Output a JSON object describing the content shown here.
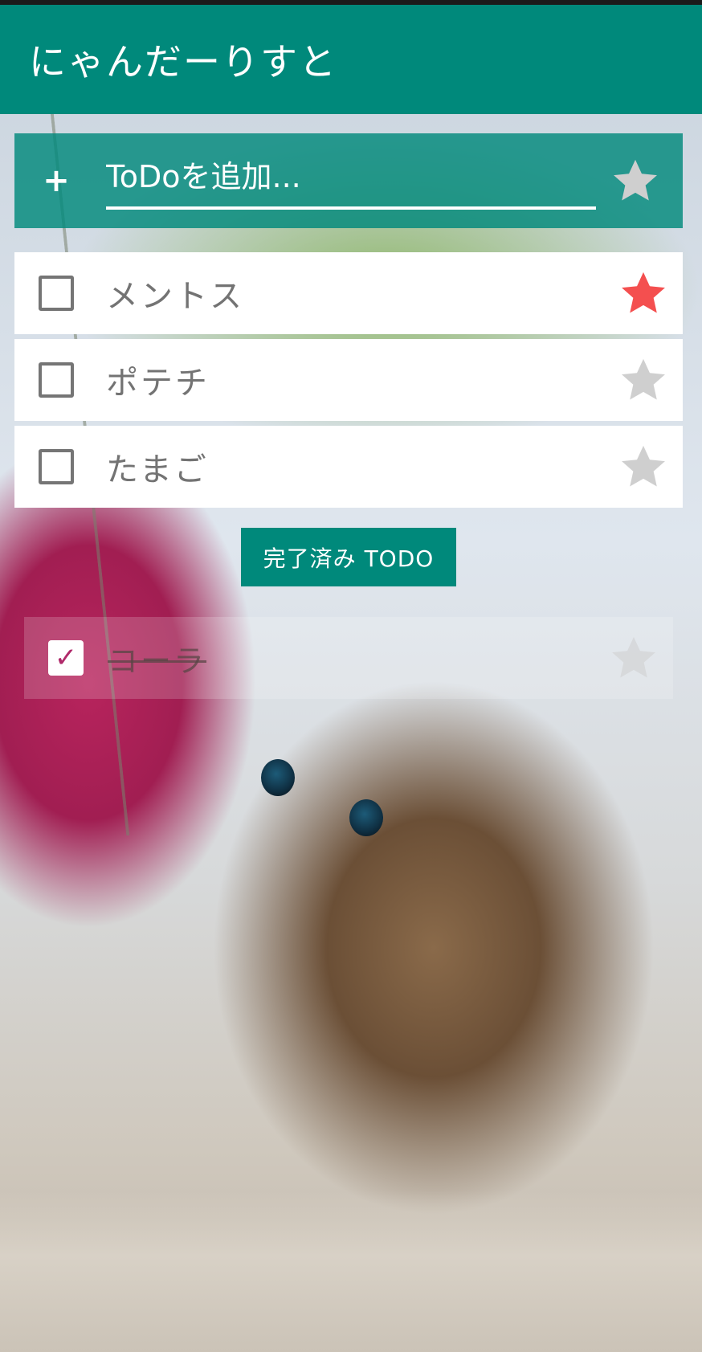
{
  "app": {
    "title": "にゃんだーりすと"
  },
  "add_bar": {
    "placeholder": "ToDoを追加...",
    "plus_symbol": "+"
  },
  "todos": [
    {
      "label": "メントス",
      "checked": false,
      "starred": true
    },
    {
      "label": "ポテチ",
      "checked": false,
      "starred": false
    },
    {
      "label": "たまご",
      "checked": false,
      "starred": false
    }
  ],
  "completed_button": {
    "label": "完了済み TODO"
  },
  "completed": [
    {
      "label": "コーラ",
      "checked": true,
      "starred": false
    }
  ],
  "colors": {
    "primary": "#00897b",
    "star_active": "#f44f4f",
    "star_inactive": "#cfcfcf",
    "star_header": "#cfcfcf",
    "check_accent": "#b02a6a"
  },
  "icons": {
    "check": "✓"
  }
}
